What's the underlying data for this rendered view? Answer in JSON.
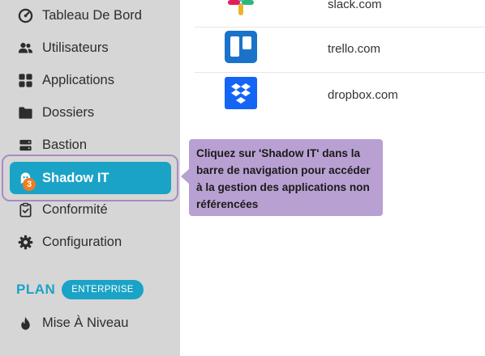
{
  "sidebar": {
    "items": [
      {
        "label": "Tableau De Bord",
        "icon": "dashboard-gauge-icon"
      },
      {
        "label": "Utilisateurs",
        "icon": "users-icon"
      },
      {
        "label": "Applications",
        "icon": "grid-apps-icon"
      },
      {
        "label": "Dossiers",
        "icon": "folder-icon"
      },
      {
        "label": "Bastion",
        "icon": "server-icon"
      },
      {
        "label": "Shadow IT",
        "icon": "ghost-icon",
        "active": true
      },
      {
        "label": "Conformité",
        "icon": "clipboard-check-icon"
      },
      {
        "label": "Configuration",
        "icon": "gear-icon"
      }
    ],
    "step_badge": "3",
    "plan": {
      "label": "PLAN",
      "badge": "ENTERPRISE"
    },
    "upgrade": {
      "label": "Mise À Niveau",
      "icon": "flame-icon"
    }
  },
  "apps": [
    {
      "name": "slack.com",
      "icon": "slack-logo-icon"
    },
    {
      "name": "trello.com",
      "icon": "trello-logo-icon"
    },
    {
      "name": "dropbox.com",
      "icon": "dropbox-logo-icon"
    }
  ],
  "tooltip": {
    "text": "Cliquez sur 'Shadow IT' dans la barre de navigation pour accéder à la gestion des applications non référencées"
  },
  "colors": {
    "accent": "#1aa3c7",
    "highlight": "#a98ac4",
    "tooltip_bg": "#b9a0d2",
    "badge": "#f07d1e",
    "trello": "#1a73c9",
    "dropbox": "#1565f5"
  }
}
